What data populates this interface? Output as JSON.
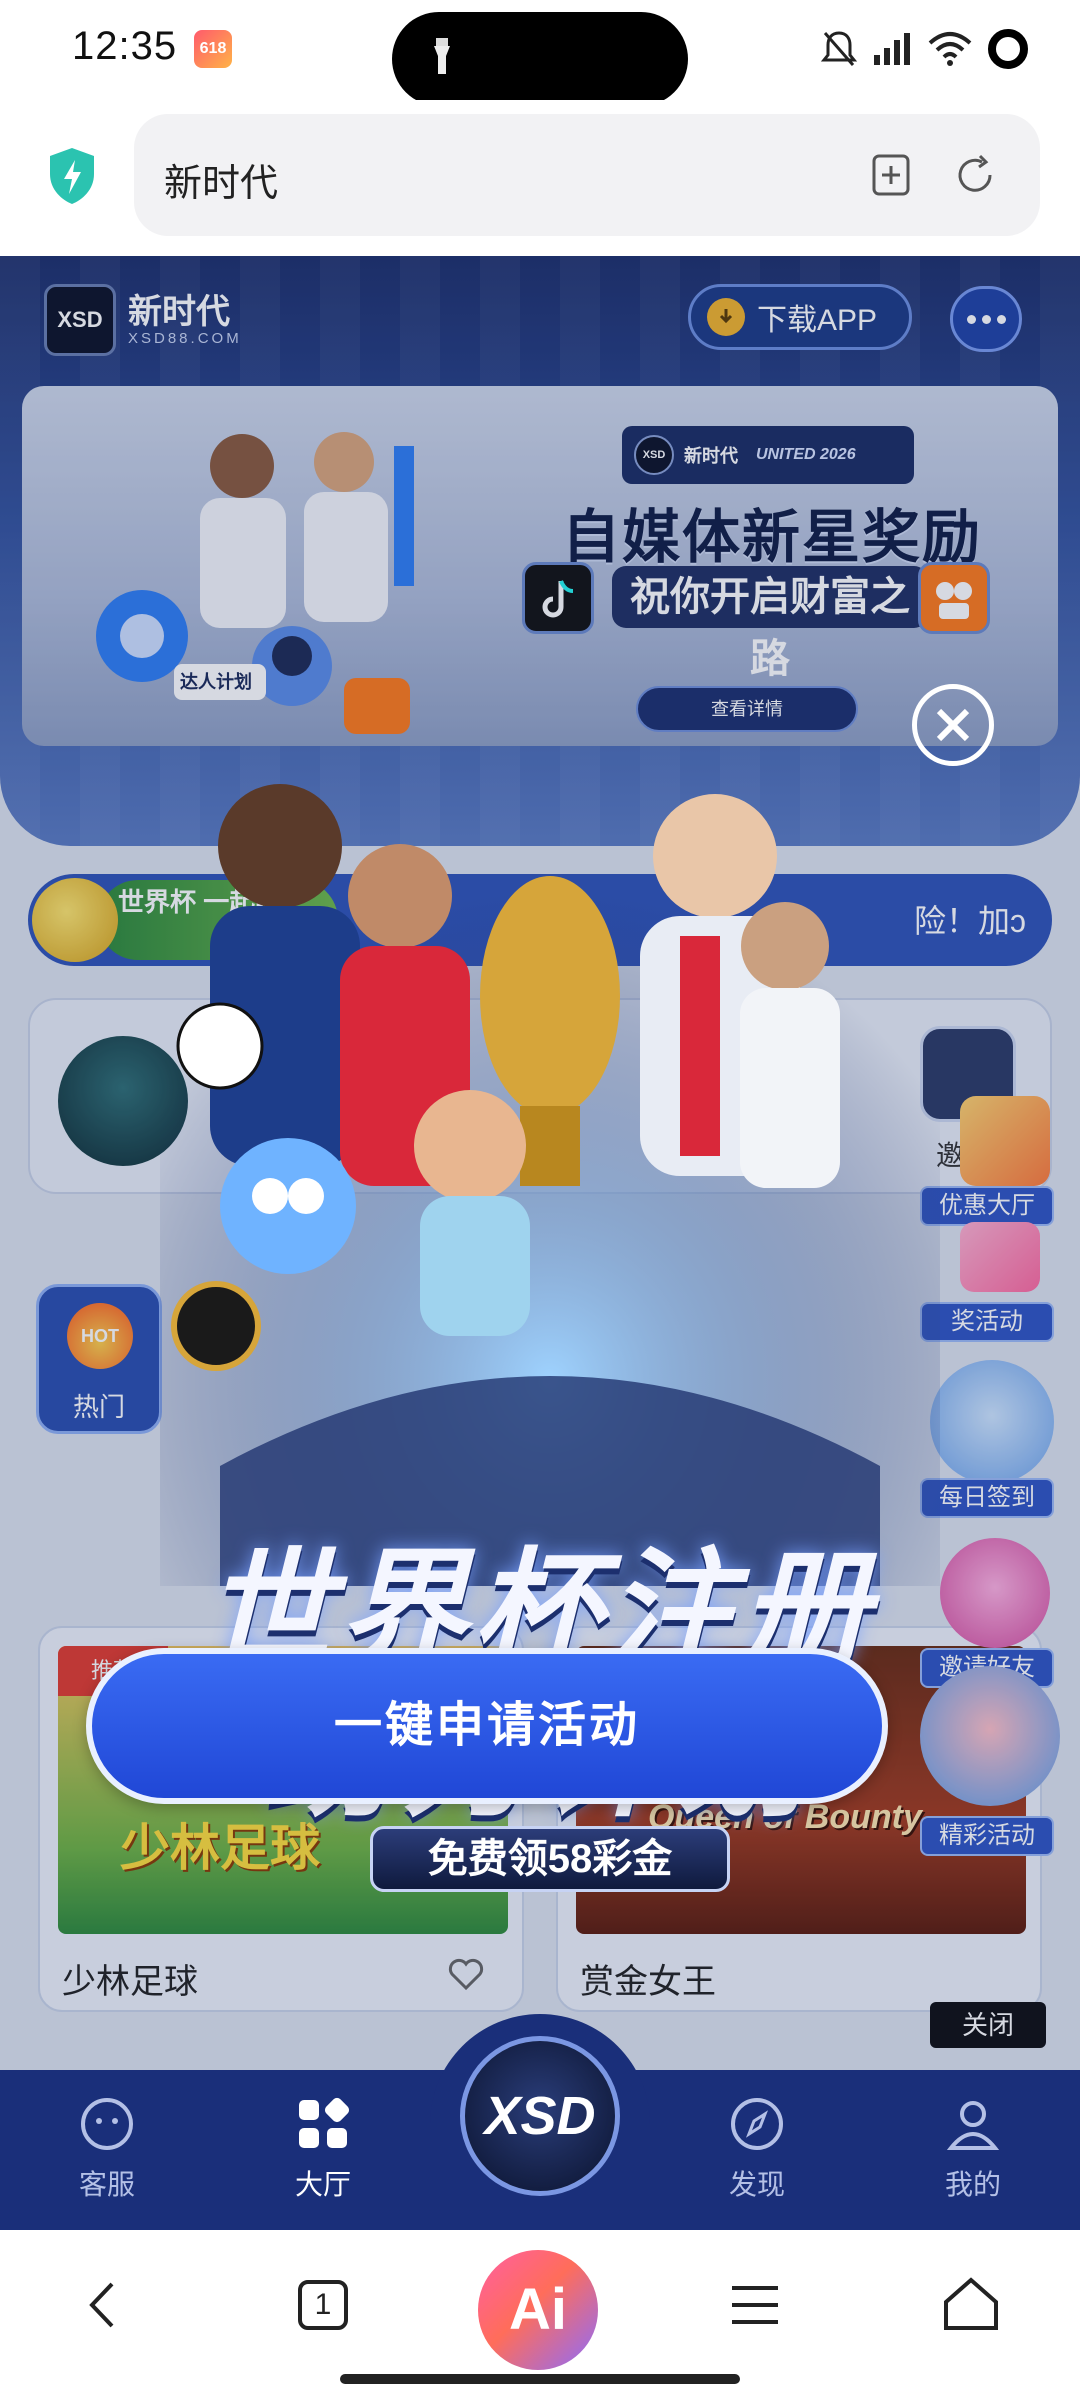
{
  "status_bar": {
    "time": "12:35",
    "app_badge": "618"
  },
  "browser": {
    "address_text": "新时代"
  },
  "site": {
    "logo_text": "XSD",
    "name": "新时代",
    "domain": "XSD88.COM",
    "download_label": "下载APP"
  },
  "banner": {
    "logo_name": "新时代",
    "logo_tag": "UNITED 2026",
    "title": "自媒体新星奖励",
    "subtitle": "祝你开启财富之路",
    "detail_button": "查看详情",
    "left_caption": "达人计划"
  },
  "marquee": {
    "green_text": "世界杯 一起嗨",
    "text": "险！加ↄ"
  },
  "wallet": {
    "invite_label": "邀请"
  },
  "hot_tab": {
    "badge": "HOT",
    "label": "热门"
  },
  "games": [
    {
      "tag": "推荐",
      "art": "少林足球",
      "title": "少林足球"
    },
    {
      "art": "Queen of Bounty",
      "title": "赏金女王"
    }
  ],
  "side_float": {
    "items": [
      "优惠大厅",
      "奖活动",
      "每日签到",
      "邀请好友",
      "精彩活动"
    ],
    "close_label": "关闭"
  },
  "popup": {
    "title_line1": "世界杯注册",
    "title_line2": "助力计划",
    "subtitle": "免费领58彩金",
    "apply_button": "一键申请活动"
  },
  "site_nav": {
    "center_logo": "XSD",
    "items": [
      {
        "label": "客服",
        "icon": "smiley-chat-icon"
      },
      {
        "label": "大厅",
        "icon": "grid-icon"
      },
      {
        "label": "发现",
        "icon": "compass-icon"
      },
      {
        "label": "我的",
        "icon": "person-icon"
      }
    ]
  },
  "toolbar": {
    "tab_count": "1",
    "ai_label": "Ai"
  },
  "colors": {
    "site_primary": "#1a2f7a",
    "button_blue": "#2a57e0",
    "shield_teal": "#2bc3b0"
  }
}
